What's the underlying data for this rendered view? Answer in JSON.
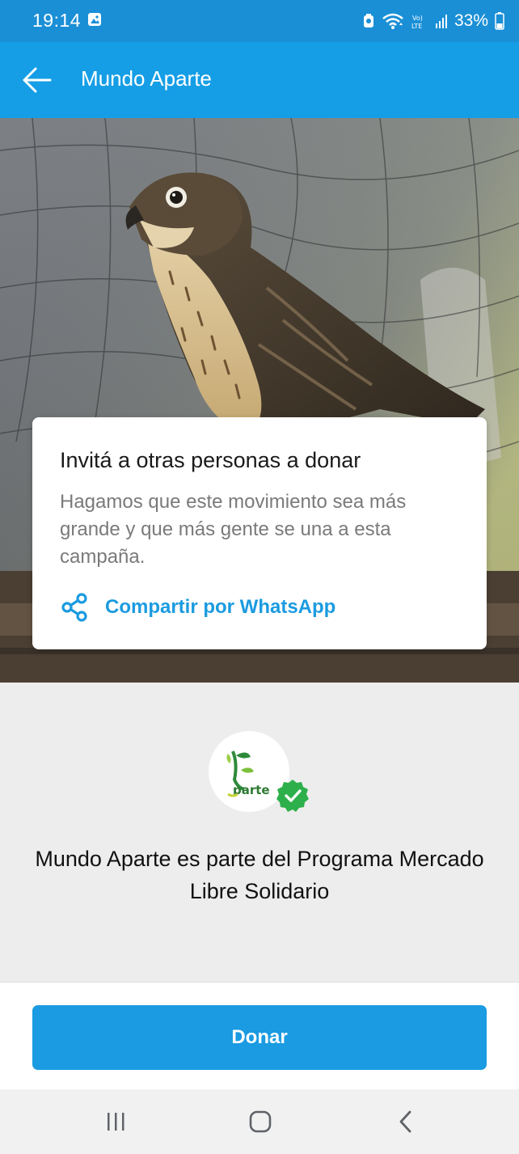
{
  "status_bar": {
    "time": "19:14",
    "battery": "33%",
    "network": "LTE",
    "icons": [
      "gallery-icon",
      "alarm-icon",
      "wifi-icon",
      "volte-icon",
      "signal-icon",
      "battery-icon"
    ]
  },
  "app_bar": {
    "title": "Mundo Aparte",
    "back_icon": "arrow-left-icon"
  },
  "hero": {
    "image": "hawk-photo"
  },
  "invite_card": {
    "title": "Invitá a otras personas a donar",
    "description": "Hagamos que este movimiento sea más grande y que más gente se una a esta campaña.",
    "share_label": "Compartir por WhatsApp",
    "share_icon": "share-icon"
  },
  "program": {
    "logo_text": "parte",
    "badge_icon": "check-icon",
    "text": "Mundo Aparte es parte del Programa Mercado Libre Solidario"
  },
  "donate_button": {
    "label": "Donar"
  },
  "colors": {
    "status_bar": "#1a8fd6",
    "app_bar": "#159ee6",
    "accent": "#1b9be0",
    "verified": "#2db04b"
  }
}
